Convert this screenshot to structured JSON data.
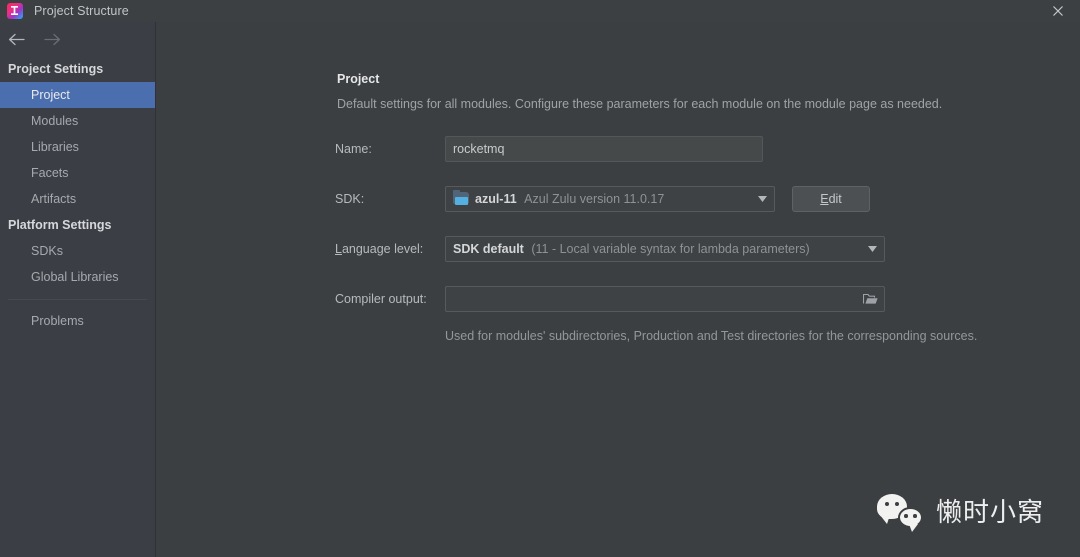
{
  "window": {
    "title": "Project Structure",
    "app_icon": "intellij-idea-icon",
    "close_icon": "close-icon"
  },
  "nav": {
    "back_icon": "arrow-left-icon",
    "forward_icon": "arrow-right-icon"
  },
  "sidebar": {
    "groups": [
      {
        "title": "Project Settings",
        "items": [
          {
            "label": "Project",
            "selected": true
          },
          {
            "label": "Modules",
            "selected": false
          },
          {
            "label": "Libraries",
            "selected": false
          },
          {
            "label": "Facets",
            "selected": false
          },
          {
            "label": "Artifacts",
            "selected": false
          }
        ]
      },
      {
        "title": "Platform Settings",
        "items": [
          {
            "label": "SDKs",
            "selected": false
          },
          {
            "label": "Global Libraries",
            "selected": false
          }
        ]
      }
    ],
    "footer_item": {
      "label": "Problems"
    }
  },
  "main": {
    "title": "Project",
    "subtitle": "Default settings for all modules. Configure these parameters for each module on the module page as needed.",
    "fields": {
      "name": {
        "label": "Name:",
        "value": "rocketmq"
      },
      "sdk": {
        "label": "SDK:",
        "icon": "jdk-folder-icon",
        "value_primary": "azul-11",
        "value_secondary": "Azul Zulu version 11.0.17",
        "dropdown_icon": "chevron-down-icon",
        "edit_button": {
          "mnemonic": "E",
          "rest": "dit"
        }
      },
      "language_level": {
        "label_mnemonic": "L",
        "label_rest": "anguage level:",
        "value_primary": "SDK default",
        "value_secondary": "(11 - Local variable syntax for lambda parameters)",
        "dropdown_icon": "chevron-down-icon"
      },
      "compiler_output": {
        "label": "Compiler output:",
        "value": "",
        "browse_icon": "folder-open-icon",
        "hint": "Used for modules' subdirectories, Production and Test directories for the corresponding sources."
      }
    }
  },
  "watermark": {
    "logo_icon": "wechat-logo-icon",
    "text": "懒时小窝"
  },
  "colors": {
    "selection": "#4b6eaf",
    "panel_bg": "#3c3f41",
    "sidebar_bg": "#3b3e45",
    "titlebar_bg": "#3c4043"
  }
}
